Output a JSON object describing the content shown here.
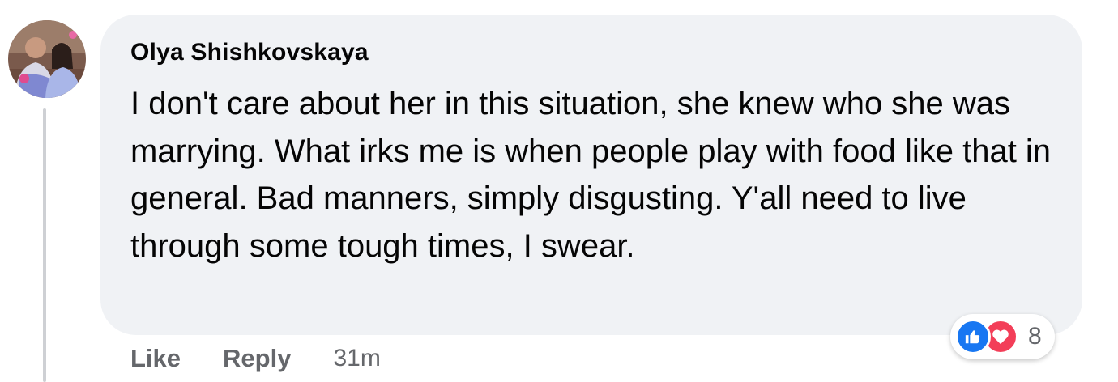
{
  "comment": {
    "author": "Olya Shishkovskaya",
    "text": "I don't care about her in this situation, she knew who she was marrying. What irks me is when people play with food like that in general. Bad manners, simply disgusting. Y'all need to live through some tough times, I swear.",
    "timestamp": "31m"
  },
  "actions": {
    "like_label": "Like",
    "reply_label": "Reply"
  },
  "reactions": {
    "types": [
      "like-icon",
      "love-icon"
    ],
    "count": "8",
    "colors": {
      "like": "#1877f2",
      "love": "#f33e58"
    }
  },
  "colors": {
    "bubble": "#f0f2f5",
    "text": "#050505",
    "secondary": "#65676b"
  }
}
